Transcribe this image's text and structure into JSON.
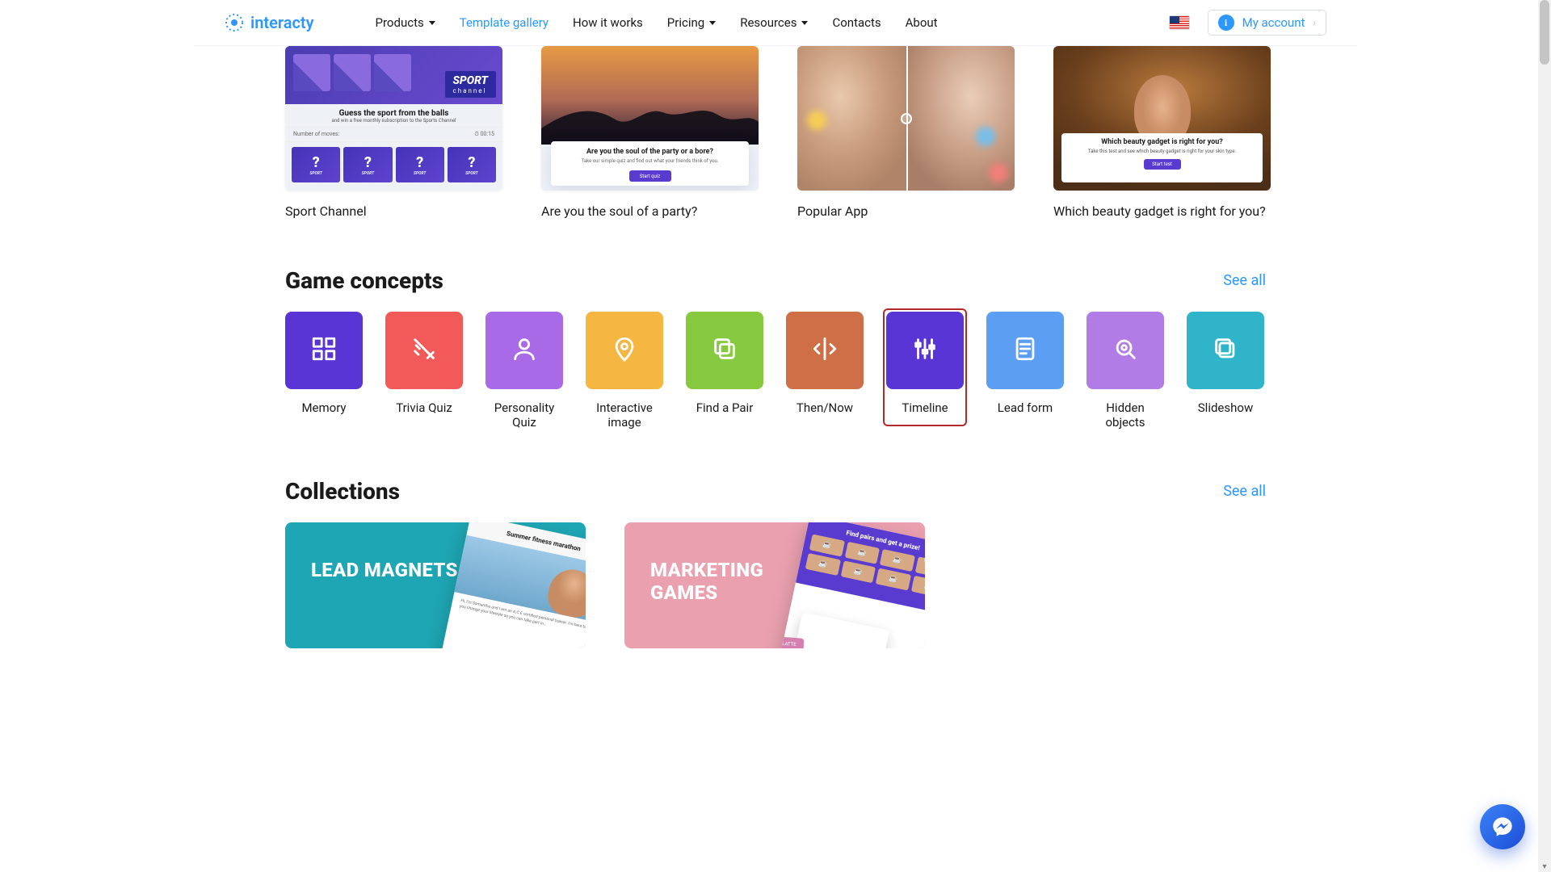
{
  "header": {
    "brand": "interacty",
    "nav": {
      "products": "Products",
      "template_gallery": "Template gallery",
      "how_it_works": "How it works",
      "pricing": "Pricing",
      "resources": "Resources",
      "contacts": "Contacts",
      "about": "About"
    },
    "account_label": "My account",
    "account_badge": "i"
  },
  "templates": {
    "cards": [
      {
        "title": "Sport Channel",
        "badge": "SPORT",
        "badge_sub": "channel",
        "heading": "Guess the sport from the balls",
        "sub": "and win a free monthly subscription to the Sports Channel",
        "moves": "Number of moves:",
        "timer": "00:15",
        "tile_mark": "?",
        "tile_label": "SPORT"
      },
      {
        "title": "Are you the soul of a party?",
        "heading": "Are you the soul of the party or a bore?",
        "sub": "Take our simple quiz and find out what your friends think of you.",
        "button": "Start quiz"
      },
      {
        "title": "Popular App"
      },
      {
        "title": "Which beauty gadget is right for you?",
        "heading": "Which beauty gadget is right for you?",
        "sub": "Take this test and see which beauty gadget is right for your skin type.",
        "button": "Start test"
      }
    ]
  },
  "game_concepts": {
    "title": "Game concepts",
    "see_all": "See all",
    "items": [
      {
        "label": "Memory",
        "color": "c-purple",
        "icon": "grid"
      },
      {
        "label": "Trivia Quiz",
        "color": "c-red",
        "icon": "check-cross"
      },
      {
        "label": "Personality Quiz",
        "color": "c-lpurp",
        "icon": "person"
      },
      {
        "label": "Interactive image",
        "color": "c-orange",
        "icon": "pin"
      },
      {
        "label": "Find a Pair",
        "color": "c-green",
        "icon": "copy"
      },
      {
        "label": "Then/Now",
        "color": "c-brown",
        "icon": "split"
      },
      {
        "label": "Timeline",
        "color": "c-purple",
        "icon": "sliders",
        "selected": true
      },
      {
        "label": "Lead form",
        "color": "c-blue",
        "icon": "form"
      },
      {
        "label": "Hidden objects",
        "color": "c-violet",
        "icon": "magnify"
      },
      {
        "label": "Slideshow",
        "color": "c-teal",
        "icon": "stack"
      }
    ]
  },
  "collections": {
    "title": "Collections",
    "see_all": "See all",
    "items": [
      {
        "title": "LEAD MAGNETS",
        "color": "col-teal",
        "art_head": "Summer fitness marathon"
      },
      {
        "title": "MARKETING GAMES",
        "color": "col-pink",
        "art_head": "Find pairs and get a prize!",
        "pill": "LATTE"
      }
    ]
  }
}
